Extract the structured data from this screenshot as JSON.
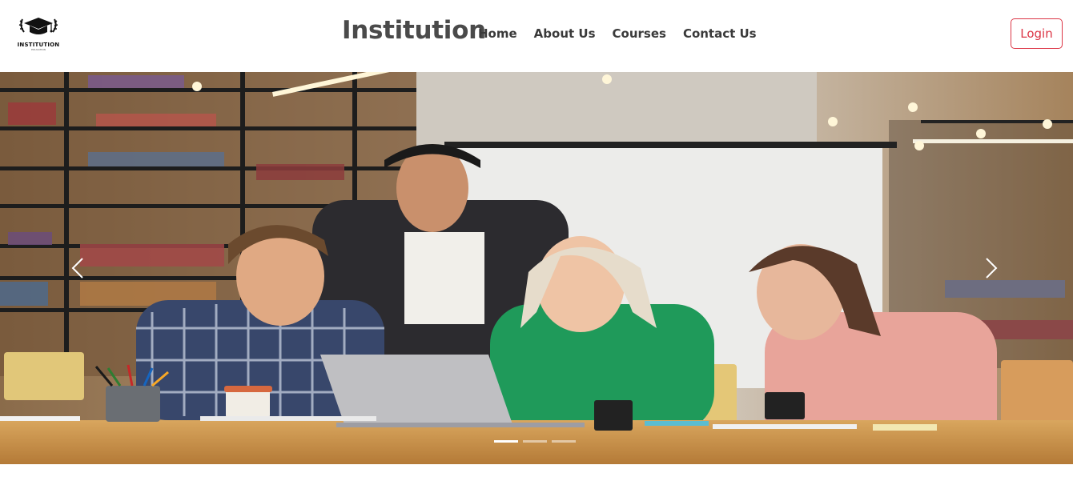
{
  "logo": {
    "text": "INSTITUTION",
    "subtext": "EDUCATION",
    "icon": "graduation-cap-icon"
  },
  "brand": {
    "title": "Institution"
  },
  "nav": {
    "items": [
      {
        "label": "Home"
      },
      {
        "label": "About Us"
      },
      {
        "label": "Courses"
      },
      {
        "label": "Contact Us"
      }
    ]
  },
  "auth": {
    "login_label": "Login"
  },
  "carousel": {
    "image": "students-studying-with-laptop-in-library",
    "slide_count": 3,
    "active_slide": 1,
    "prev_icon": "chevron-left-icon",
    "next_icon": "chevron-right-icon"
  },
  "colors": {
    "accent": "#dc3545",
    "brand_text": "#4a4a4a",
    "nav_text": "#3a3a3a"
  }
}
